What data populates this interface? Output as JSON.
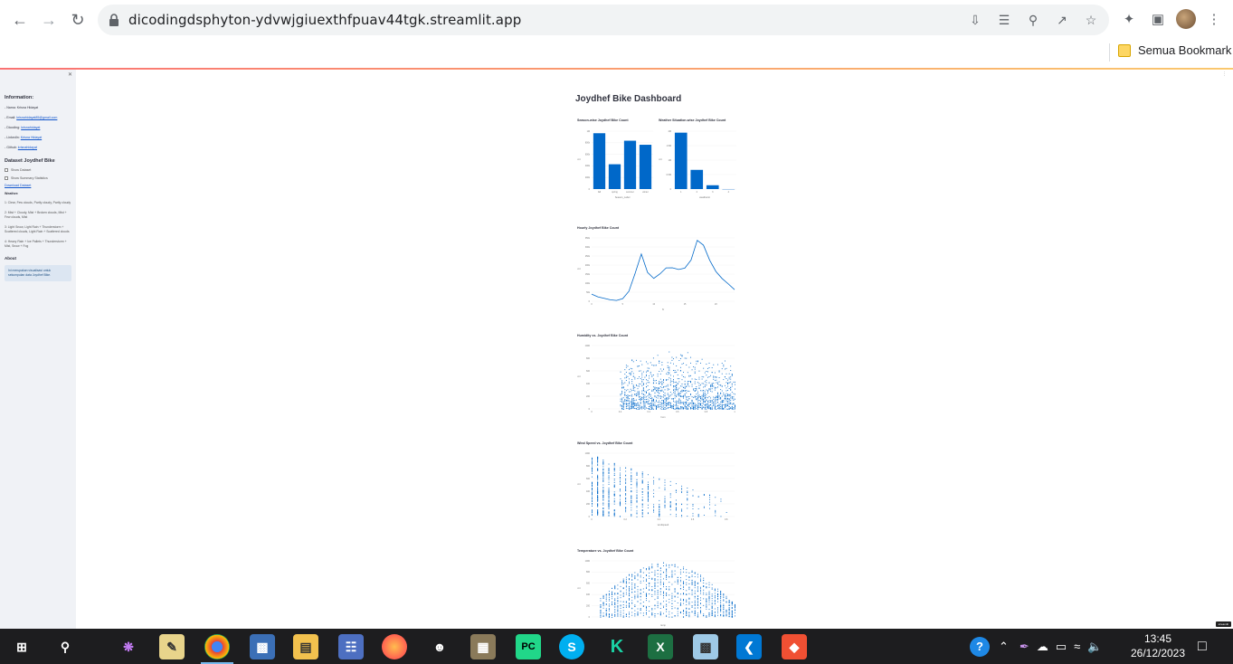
{
  "browser": {
    "url": "dicodingdsphyton-ydvwjgiuexthfpuav44tgk.streamlit.app",
    "bookmark_label": "Semua Bookmark",
    "icons": [
      "back-icon",
      "forward-icon",
      "reload-icon",
      "lock-icon",
      "install-icon",
      "translate-icon",
      "zoom-icon",
      "share-icon",
      "star-icon",
      "extensions-icon",
      "side-panel-icon",
      "menu-icon"
    ]
  },
  "sidebar": {
    "information_heading": "Information:",
    "nama_prefix": "- Nama:",
    "nama": "Krisna Hidayat",
    "email_prefix": "- Email:",
    "email": "krisnahidayat85@gmail.com",
    "dicoding_prefix": "- Dicoding:",
    "dicoding": "krisnahidayat",
    "linkedin_prefix": "- LinkedIn:",
    "linkedin": "Krisna Hidayat",
    "github_prefix": "- Github:",
    "github": "krisnahidayat",
    "dataset_heading": "Dataset Joydhef Bike",
    "show_dataset": "Show Dataset",
    "show_summary": "Show Summary Statistics",
    "download": "Download Dataset",
    "weather_heading": "Weather:",
    "weather": [
      "1: Clear, Few clouds, Partly cloudy, Partly cloudy",
      "2: Mist + Cloudy, Mist + Broken clouds, Mist + Few clouds, Mist",
      "3: Light Snow, Light Rain + Thunderstorm + Scattered clouds, Light Rain + Scattered clouds",
      "4: Heavy Rain + Ice Pallets + Thunderstorm + Mist, Snow + Fog"
    ],
    "about_heading": "About",
    "about_text": "Ini merupakan visualisasi untuk sekumpulan data Joydhef Bike."
  },
  "main": {
    "title": "Joydhef Bike Dashboard",
    "made_with": "streamlit"
  },
  "chart_data": [
    {
      "type": "bar",
      "title": "Season-wise Joydhef Bike Count",
      "categories": [
        "fall",
        "spring",
        "summer",
        "winter"
      ],
      "values": [
        1061129,
        471348,
        918589,
        841613
      ],
      "xlabel": "Season_Label",
      "ylabel": "cnt",
      "ylim": [
        0,
        1100000
      ],
      "yticks": [
        "0",
        "200k",
        "400k",
        "600k",
        "800k",
        "1M"
      ],
      "color": "#0068c9"
    },
    {
      "type": "bar",
      "title": "Weather Situation-wise Joydhef Bike Count",
      "categories": [
        "1",
        "2",
        "3",
        "4"
      ],
      "values": [
        2338173,
        795952,
        158331,
        223
      ],
      "xlabel": "weathersit",
      "ylabel": "cnt",
      "ylim": [
        0,
        2400000
      ],
      "yticks": [
        "0",
        "0.5M",
        "1M",
        "1.5M",
        "2M"
      ],
      "color": "#0068c9"
    },
    {
      "type": "line",
      "title": "Hourly Joydhef Bike Count",
      "x": [
        0,
        1,
        2,
        3,
        4,
        5,
        6,
        7,
        8,
        9,
        10,
        11,
        12,
        13,
        14,
        15,
        16,
        17,
        18,
        19,
        20,
        21,
        22,
        23
      ],
      "y": [
        39130,
        24164,
        16352,
        8174,
        4428,
        14261,
        55132,
        154171,
        261001,
        159438,
        126257,
        151320,
        184414,
        184919,
        175652,
        183149,
        227748,
        336860,
        309772,
        226789,
        164550,
        125445,
        95612,
        63941
      ],
      "xlabel": "hr",
      "ylabel": "cnt",
      "xticks": [
        "0",
        "5",
        "10",
        "15",
        "20"
      ],
      "yticks": [
        "0",
        "50k",
        "100k",
        "150k",
        "200k",
        "250k",
        "300k",
        "350k"
      ],
      "ylim": [
        0,
        350000
      ],
      "color": "#0068c9"
    },
    {
      "type": "scatter",
      "title": "Humidity vs. Joydhef Bike Count",
      "xlabel": "hum",
      "ylabel": "cnt",
      "xlim": [
        0,
        1
      ],
      "ylim": [
        0,
        1000
      ],
      "xticks": [
        "0",
        "0.2",
        "0.4",
        "0.6",
        "0.8",
        "1"
      ],
      "yticks": [
        "0",
        "200",
        "400",
        "600",
        "800",
        "1000"
      ],
      "color": "#0068c9"
    },
    {
      "type": "scatter",
      "title": "Wind Speed vs. Joydhef Bike Count",
      "xlabel": "windspeed",
      "ylabel": "cnt",
      "xlim": [
        0,
        0.85
      ],
      "ylim": [
        0,
        1000
      ],
      "xticks": [
        "0",
        "0.2",
        "0.4",
        "0.6",
        "0.8"
      ],
      "yticks": [
        "0",
        "200",
        "400",
        "600",
        "800",
        "1000"
      ],
      "color": "#0068c9"
    },
    {
      "type": "scatter",
      "title": "Temperature vs. Joydhef Bike Count",
      "xlabel": "temp",
      "ylabel": "cnt",
      "xlim": [
        0,
        1
      ],
      "ylim": [
        0,
        1000
      ],
      "yticks": [
        "0",
        "200",
        "400",
        "600",
        "800",
        "1000"
      ],
      "color": "#0068c9"
    }
  ],
  "taskbar": {
    "apps": [
      "start-icon",
      "search-icon",
      "taskview-icon",
      "paint-icon",
      "chrome-icon",
      "vm-icon",
      "file-explorer-icon",
      "pdf-icon",
      "firefox-icon",
      "app-icon",
      "winrar-icon",
      "pycharm-icon",
      "skype-icon",
      "kotlin-icon",
      "excel-icon",
      "notepad-icon",
      "vscode-icon",
      "git-icon"
    ],
    "time": "13:45",
    "date": "26/12/2023"
  }
}
